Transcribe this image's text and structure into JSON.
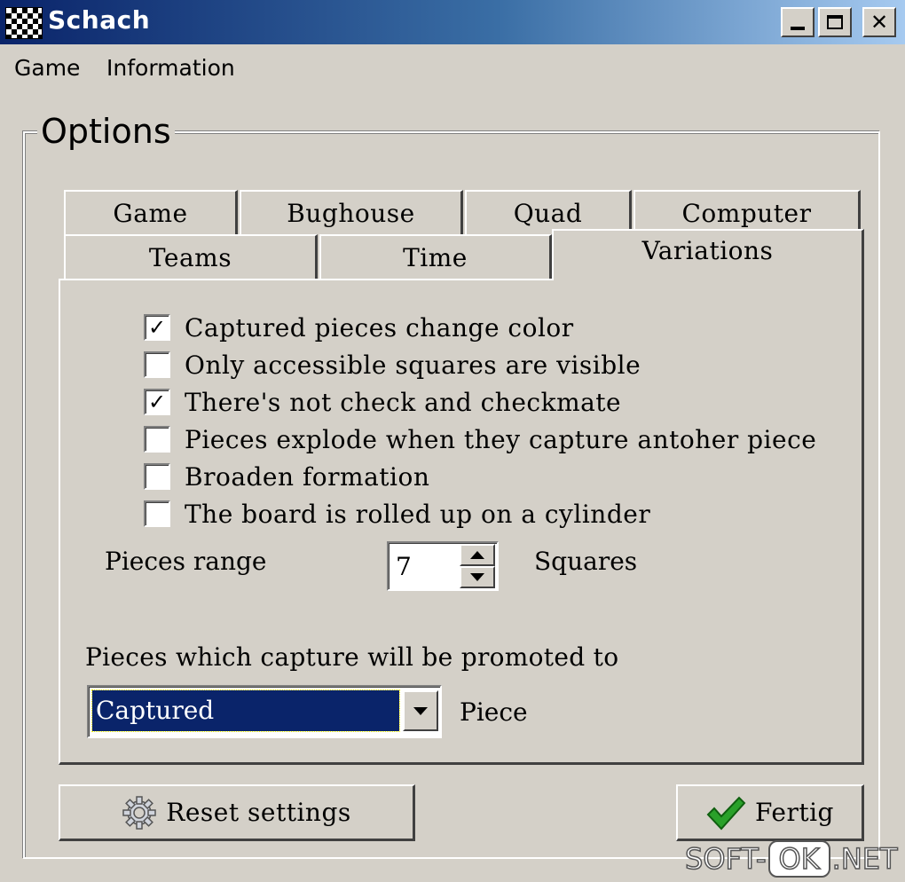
{
  "window": {
    "title": "Schach"
  },
  "menu": {
    "items": [
      "Game",
      "Information"
    ]
  },
  "options": {
    "group_title": "Options",
    "tabs_top": [
      "Game",
      "Bughouse",
      "Quad",
      "Computer"
    ],
    "tabs_bottom": [
      "Teams",
      "Time",
      "Variations"
    ],
    "active_tab": "Variations"
  },
  "variations": {
    "checkboxes": [
      {
        "label": "Captured pieces change color",
        "checked": true
      },
      {
        "label": "Only accessible squares are visible",
        "checked": false
      },
      {
        "label": "There's not check and checkmate",
        "checked": true
      },
      {
        "label": "Pieces explode when they capture antoher piece",
        "checked": false
      },
      {
        "label": "Broaden formation",
        "checked": false
      },
      {
        "label": "The board is rolled up on a cylinder",
        "checked": false
      }
    ],
    "range_label": "Pieces range",
    "range_value": "7",
    "range_unit": "Squares",
    "promote_label": "Pieces which capture will be promoted to",
    "promote_value": "Captured",
    "promote_unit": "Piece"
  },
  "buttons": {
    "reset": "Reset settings",
    "done": "Fertig"
  },
  "watermark": {
    "left": "SOFT-",
    "box": "OK",
    "right": ".NET"
  }
}
